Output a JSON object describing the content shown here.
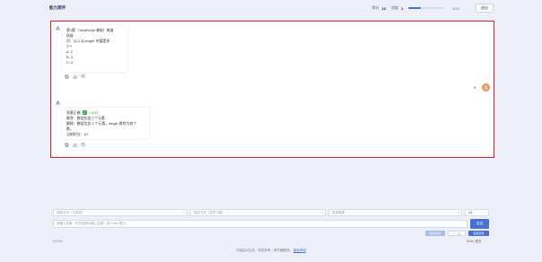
{
  "header": {
    "brand": "能力测评",
    "stat1_label": "得分",
    "stat1_value": "10",
    "stat2_label": "进度",
    "stat2_value": "1",
    "progress_fraction": 0.35,
    "progress_text": "1/10",
    "action_label": "退出"
  },
  "messages": [
    {
      "role": "assistant",
      "lines": [
        "第1题（JavaScript 基础）难度",
        "低级",
        "问：'[1,2,3].length' 的值是多",
        "少?",
        "A. 2",
        "B. 3",
        "C. 4"
      ]
    },
    {
      "role": "user",
      "text": "B",
      "label": "我"
    },
    {
      "role": "assistant",
      "verdict": "答案正确",
      "points": "+10分",
      "lines": [
        "解答：数组包含三个元素",
        "解释：数组包含 3 个元素，length 属性为其个",
        "数。",
        "当前积分：10"
      ]
    }
  ],
  "icons": {
    "copy": "copy-icon",
    "like": "thumbs-up-icon",
    "dislike": "thumbs-down-icon"
  },
  "input": {
    "topic_placeholder": "选择方向（可选填）",
    "domain_placeholder": "指定方向（如学习等）",
    "level_placeholder": "选择难度",
    "count_value": "10",
    "message_placeholder": "请输入答案（可在选择后输入答案，按 Enter 提交）",
    "send_label": "发送",
    "btn_a": "提交答案",
    "btn_b": "下一题",
    "btn_c": "结束测评",
    "char_count": "0/2000",
    "hint_right": "Enter 提交"
  },
  "footer": {
    "text": "内容由AI生成，仅供参考，请仔细甄别。",
    "link": "隐私声明"
  },
  "colors": {
    "accent": "#4a70d8",
    "highlight_border": "#e01e26",
    "user_avatar": "#f39257",
    "correct": "#3aaa4c"
  }
}
